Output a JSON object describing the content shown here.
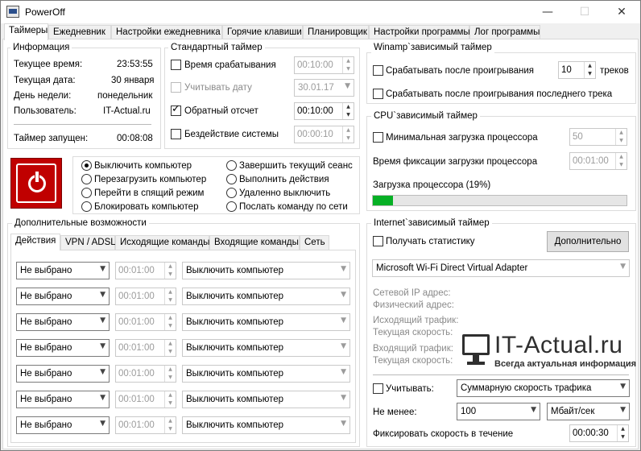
{
  "window": {
    "title": "PowerOff",
    "controls": {
      "minimize": "—",
      "maximize": "☐",
      "close": "✕"
    }
  },
  "main_tabs": [
    "Таймеры",
    "Ежедневник",
    "Настройки ежедневника",
    "Горячие клавиши",
    "Планировщик",
    "Настройки программы",
    "Лог программы"
  ],
  "info": {
    "title": "Информация",
    "rows": [
      {
        "label": "Текущее время:",
        "value": "23:53:55"
      },
      {
        "label": "Текущая дата:",
        "value": "30 января"
      },
      {
        "label": "День недели:",
        "value": "понедельник"
      },
      {
        "label": "Пользователь:",
        "value": "IT-Actual.ru"
      }
    ],
    "timer_started_label": "Таймер запущен:",
    "timer_started_value": "00:08:08"
  },
  "standard_timer": {
    "title": "Стандартный таймер",
    "rows": [
      {
        "label": "Время срабатывания",
        "checked": false,
        "enabled": true,
        "value": "00:10:00",
        "control": "spin",
        "value_enabled": false
      },
      {
        "label": "Учитывать дату",
        "checked": false,
        "enabled": false,
        "value": "30.01.17",
        "control": "combo",
        "value_enabled": false
      },
      {
        "label": "Обратный отсчет",
        "checked": true,
        "enabled": true,
        "value": "00:10:00",
        "control": "spin",
        "value_enabled": true
      },
      {
        "label": "Бездействие системы",
        "checked": false,
        "enabled": true,
        "value": "00:00:10",
        "control": "spin",
        "value_enabled": false
      }
    ]
  },
  "actions": {
    "left": [
      "Выключить компьютер",
      "Перезагрузить компьютер",
      "Перейти в спящий режим",
      "Блокировать компьютер"
    ],
    "right": [
      "Завершить текущий сеанс",
      "Выполнить действия",
      "Удаленно выключить",
      "Послать команду по сети"
    ],
    "selected": "Выключить компьютер"
  },
  "extra": {
    "title": "Дополнительные возможности",
    "tabs": [
      "Действия",
      "VPN / ADSL",
      "Исходящие команды",
      "Входящие команды",
      "Сеть"
    ],
    "row_select": "Не выбрано",
    "row_time": "00:01:00",
    "row_action": "Выключить компьютер",
    "row_count": 7
  },
  "winamp": {
    "title": "Winamp`зависимый таймер",
    "after_play_label": "Срабатывать после проигрывания",
    "tracks_value": "10",
    "tracks_label": "треков",
    "after_last_label": "Срабатывать после проигрывания последнего трека"
  },
  "cpu": {
    "title": "CPU`зависимый таймер",
    "min_load_label": "Минимальная загрузка процессора",
    "min_load_value": "50",
    "fix_time_label": "Время фиксации загрузки процессора",
    "fix_time_value": "00:01:00",
    "load_label": "Загрузка процессора (19%)",
    "load_percent": 19
  },
  "internet": {
    "title": "Internet`зависимый таймер",
    "stats_label": "Получать статистику",
    "more_button": "Дополнительно",
    "adapter": "Microsoft Wi-Fi Direct Virtual Adapter",
    "info_lines": [
      "Сетевой IP адрес:",
      "Физический адрес:",
      "Исходящий трафик:",
      "Текущая скорость:",
      "Входящий трафик:",
      "Текущая скорость:"
    ],
    "count_label": "Учитывать:",
    "count_value": "Суммарную скорость трафика",
    "min_label": "Не менее:",
    "min_value": "100",
    "unit_value": "Мбайт/сек",
    "fix_label": "Фиксировать скорость в течение",
    "fix_value": "00:00:30"
  },
  "watermark": {
    "title": "IT-Actual.ru",
    "subtitle": "Всегда актуальная информация"
  },
  "colors": {
    "power_button": "#c00000",
    "progress_fill": "#06b025"
  }
}
